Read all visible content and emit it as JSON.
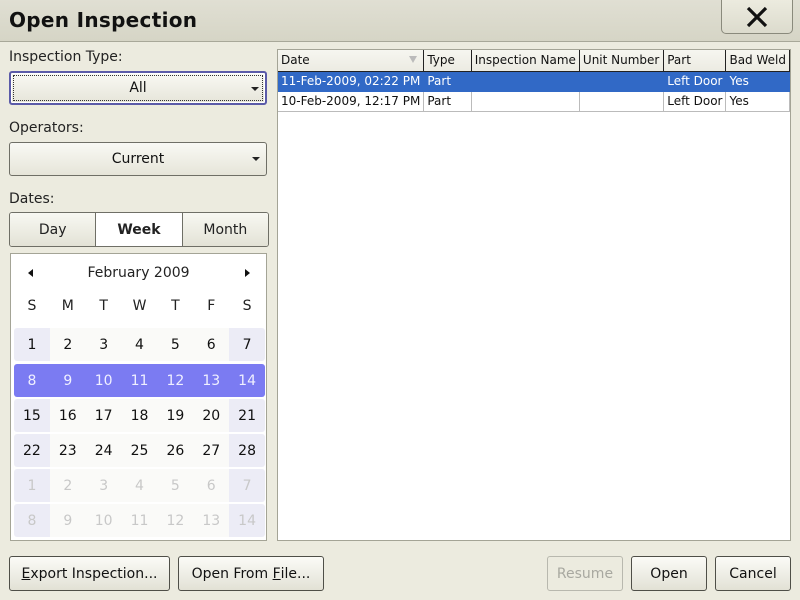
{
  "window": {
    "title": "Open Inspection",
    "close_icon": "close-icon"
  },
  "filters": {
    "inspection_type": {
      "label": "Inspection Type:",
      "value": "All"
    },
    "operators": {
      "label": "Operators:",
      "value": "Current"
    },
    "dates": {
      "label": "Dates:",
      "range_options": [
        "Day",
        "Week",
        "Month"
      ],
      "selected_range": "Week"
    }
  },
  "calendar": {
    "month_label": "February 2009",
    "weekdays": [
      "S",
      "M",
      "T",
      "W",
      "T",
      "F",
      "S"
    ],
    "weeks": [
      {
        "days": [
          "1",
          "2",
          "3",
          "4",
          "5",
          "6",
          "7"
        ],
        "state": "current"
      },
      {
        "days": [
          "8",
          "9",
          "10",
          "11",
          "12",
          "13",
          "14"
        ],
        "state": "selected"
      },
      {
        "days": [
          "15",
          "16",
          "17",
          "18",
          "19",
          "20",
          "21"
        ],
        "state": "current"
      },
      {
        "days": [
          "22",
          "23",
          "24",
          "25",
          "26",
          "27",
          "28"
        ],
        "state": "current"
      },
      {
        "days": [
          "1",
          "2",
          "3",
          "4",
          "5",
          "6",
          "7"
        ],
        "state": "other"
      },
      {
        "days": [
          "8",
          "9",
          "10",
          "11",
          "12",
          "13",
          "14"
        ],
        "state": "other"
      }
    ],
    "selected_color": "#7b7bf2"
  },
  "table": {
    "columns": [
      "Date",
      "Type",
      "Inspection Name",
      "Unit Number",
      "Part",
      "Bad Weld"
    ],
    "sort_column": "Date",
    "rows": [
      {
        "date": "11-Feb-2009, 02:22 PM",
        "type": "Part",
        "inspection_name": "",
        "unit_number": "",
        "part": "Left Door",
        "bad_weld": "Yes",
        "selected": true
      },
      {
        "date": "10-Feb-2009, 12:17 PM",
        "type": "Part",
        "inspection_name": "",
        "unit_number": "",
        "part": "Left Door",
        "bad_weld": "Yes",
        "selected": false
      }
    ],
    "selection_color": "#3169c6"
  },
  "buttons": {
    "export": {
      "pre": "",
      "mnemonic": "E",
      "post": "xport Inspection..."
    },
    "open_file": {
      "pre": "Open From ",
      "mnemonic": "F",
      "post": "ile..."
    },
    "resume": "Resume",
    "open": "Open",
    "cancel": "Cancel"
  }
}
